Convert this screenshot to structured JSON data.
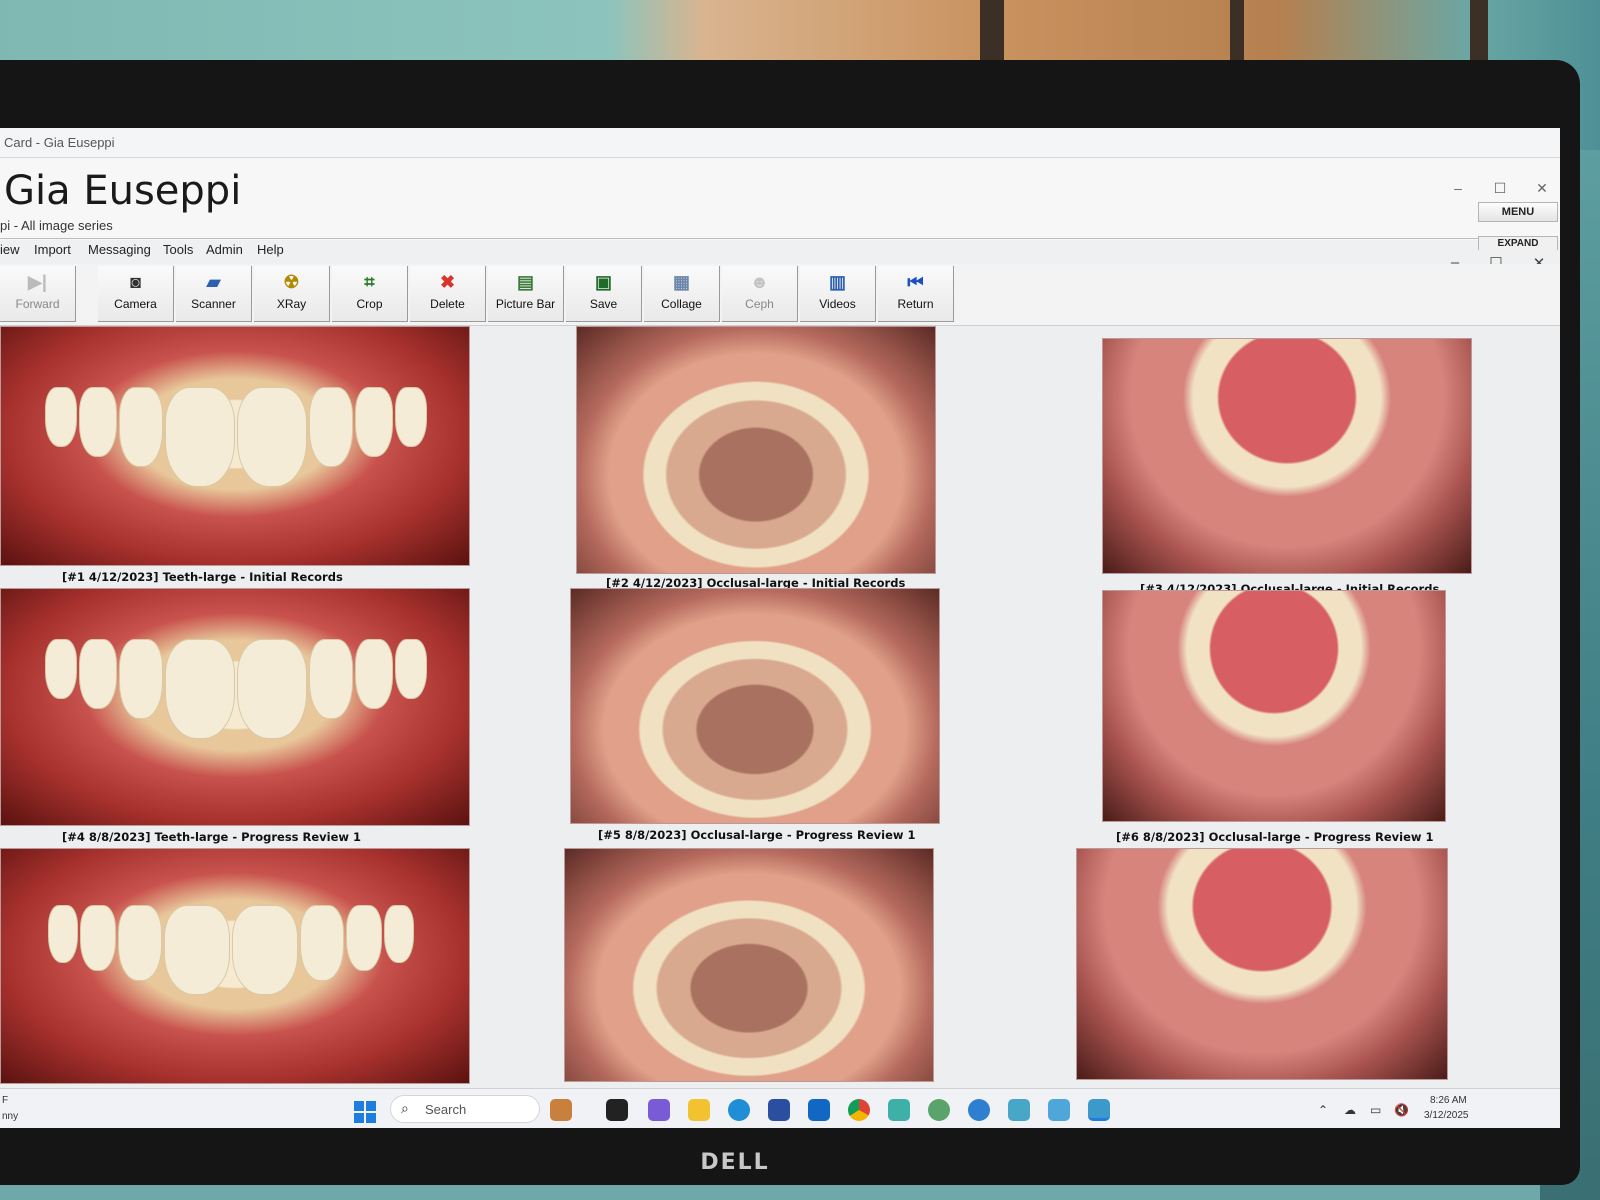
{
  "window": {
    "title_fragment": "Card - Gia Euseppi",
    "patient_name": "Gia Euseppi",
    "subtitle": "pi - All image series",
    "menu_button": "MENU",
    "expand_button": "EXPAND",
    "outer_controls": {
      "minimize": "–",
      "maximize": "☐",
      "close": "✕"
    },
    "inner_controls": {
      "minimize": "–",
      "maximize": "☐",
      "close": "✕"
    }
  },
  "menubar": [
    "iew",
    "Import",
    "Messaging",
    "Tools",
    "Admin",
    "Help"
  ],
  "toolbar": [
    {
      "label": "Forward",
      "icon": "forward-icon",
      "enabled": false
    },
    {
      "label": "Camera",
      "icon": "camera-icon",
      "enabled": true
    },
    {
      "label": "Scanner",
      "icon": "scanner-icon",
      "enabled": true
    },
    {
      "label": "XRay",
      "icon": "radiation-icon",
      "enabled": true
    },
    {
      "label": "Crop",
      "icon": "crop-icon",
      "enabled": true
    },
    {
      "label": "Delete",
      "icon": "delete-x-icon",
      "enabled": true
    },
    {
      "label": "Picture Bar",
      "icon": "picture-bar-icon",
      "enabled": true
    },
    {
      "label": "Save",
      "icon": "floppy-save-icon",
      "enabled": true
    },
    {
      "label": "Collage",
      "icon": "collage-grid-icon",
      "enabled": true
    },
    {
      "label": "Ceph",
      "icon": "ceph-skull-icon",
      "enabled": false
    },
    {
      "label": "Videos",
      "icon": "film-icon",
      "enabled": true
    },
    {
      "label": "Return",
      "icon": "rewind-icon",
      "enabled": true
    }
  ],
  "images": [
    {
      "caption": "[#1  4/12/2023] Teeth-large - Initial Records",
      "type": "front"
    },
    {
      "caption": "[#2  4/12/2023] Occlusal-large - Initial Records",
      "type": "upper"
    },
    {
      "caption": "[#3  4/12/2023] Occlusal-large - Initial Records",
      "type": "lower"
    },
    {
      "caption": "[#4  8/8/2023] Teeth-large - Progress Review 1",
      "type": "front"
    },
    {
      "caption": "[#5  8/8/2023] Occlusal-large - Progress Review 1",
      "type": "upper"
    },
    {
      "caption": "[#6  8/8/2023] Occlusal-large - Progress Review 1",
      "type": "lower"
    },
    {
      "caption": "",
      "type": "front"
    },
    {
      "caption": "",
      "type": "upper"
    },
    {
      "caption": "",
      "type": "lower"
    }
  ],
  "taskbar": {
    "search_placeholder": "Search",
    "time": "8:26 AM",
    "date": "3/12/2025",
    "left_edge_text_1": "F",
    "left_edge_text_2": "nny"
  },
  "monitor": {
    "brand": "DELL"
  },
  "colors": {
    "accent_blue": "#1d7de0",
    "delete_red": "#d9342b",
    "xray_yellow": "#e0b400"
  }
}
